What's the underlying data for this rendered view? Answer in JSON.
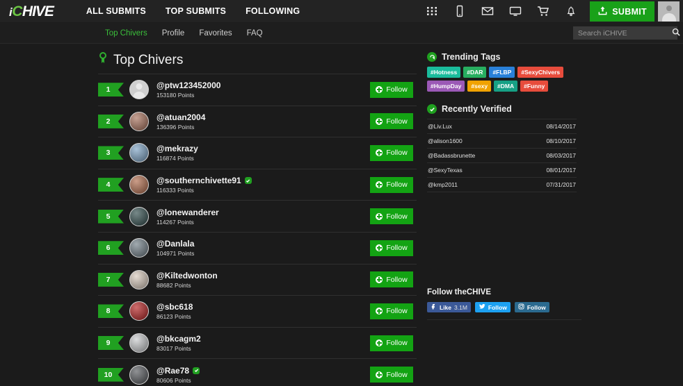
{
  "header": {
    "logo": {
      "i": "i",
      "c": "C",
      "rest": "HIVE"
    },
    "nav": [
      {
        "label": "ALL SUBMITS",
        "name": "nav-all-submits"
      },
      {
        "label": "TOP SUBMITS",
        "name": "nav-top-submits"
      },
      {
        "label": "FOLLOWING",
        "name": "nav-following"
      }
    ],
    "icons": [
      "grid-icon",
      "phone-icon",
      "envelope-icon",
      "monitor-icon",
      "cart-icon",
      "bell-icon"
    ],
    "submit_label": "SUBMIT",
    "avatar": "user-avatar"
  },
  "subnav": {
    "items": [
      {
        "label": "Top Chivers",
        "active": true
      },
      {
        "label": "Profile",
        "active": false
      },
      {
        "label": "Favorites",
        "active": false
      },
      {
        "label": "FAQ",
        "active": false
      }
    ],
    "search": {
      "placeholder": "Search iCHIVE",
      "value": ""
    }
  },
  "main": {
    "title": "Top Chivers",
    "follow_label": "Follow",
    "chivers": [
      {
        "rank": "1",
        "name": "@ptw123452000",
        "points": "153180 Points",
        "verified": false,
        "avatar": "#cfcfcf",
        "placeholder": true
      },
      {
        "rank": "2",
        "name": "@atuan2004",
        "points": "136396 Points",
        "verified": false,
        "avatar": "#a8705a",
        "placeholder": false
      },
      {
        "rank": "3",
        "name": "@mekrazy",
        "points": "116874 Points",
        "verified": false,
        "avatar": "#7ba2c4",
        "placeholder": false
      },
      {
        "rank": "4",
        "name": "@southernchivette91",
        "points": "116333 Points",
        "verified": true,
        "avatar": "#b06a4a",
        "placeholder": false
      },
      {
        "rank": "5",
        "name": "@lonewanderer",
        "points": "114267 Points",
        "verified": false,
        "avatar": "#2e4a4a",
        "placeholder": false
      },
      {
        "rank": "6",
        "name": "@Danlala",
        "points": "104971 Points",
        "verified": false,
        "avatar": "#6f7d86",
        "placeholder": false
      },
      {
        "rank": "7",
        "name": "@Kiltedwonton",
        "points": "88682 Points",
        "verified": false,
        "avatar": "#d9cbbd",
        "placeholder": false
      },
      {
        "rank": "8",
        "name": "@sbc618",
        "points": "86123 Points",
        "verified": false,
        "avatar": "#b61f1f",
        "placeholder": false
      },
      {
        "rank": "9",
        "name": "@bkcagm2",
        "points": "83017 Points",
        "verified": false,
        "avatar": "#c9cbcd",
        "placeholder": false
      },
      {
        "rank": "10",
        "name": "@Rae78",
        "points": "80606 Points",
        "verified": true,
        "avatar": "#55585c",
        "placeholder": false
      }
    ]
  },
  "sidebar": {
    "trending": {
      "title": "Trending Tags",
      "tags": [
        {
          "label": "#Hotness",
          "color": "#1abc9c"
        },
        {
          "label": "#DAR",
          "color": "#27ae60"
        },
        {
          "label": "#FLBP",
          "color": "#2980d9"
        },
        {
          "label": "#SexyChivers",
          "color": "#e74c3c"
        },
        {
          "label": "#HumpDay",
          "color": "#9b59b6"
        },
        {
          "label": "#sexy",
          "color": "#f0a202"
        },
        {
          "label": "#DMA",
          "color": "#16a085"
        },
        {
          "label": "#Funny",
          "color": "#e74c3c"
        }
      ]
    },
    "recently_verified": {
      "title": "Recently Verified",
      "rows": [
        {
          "user": "@Liv.Lux",
          "date": "08/14/2017"
        },
        {
          "user": "@alison1600",
          "date": "08/10/2017"
        },
        {
          "user": "@Badassbrunette",
          "date": "08/03/2017"
        },
        {
          "user": "@SexyTexas",
          "date": "08/01/2017"
        },
        {
          "user": "@kmp2011",
          "date": "07/31/2017"
        }
      ]
    },
    "follow_chive": {
      "title": "Follow theCHIVE",
      "buttons": [
        {
          "label": "Like",
          "count": "3.1M",
          "network": "facebook",
          "class": "fb"
        },
        {
          "label": "Follow",
          "count": "",
          "network": "twitter",
          "class": "tw"
        },
        {
          "label": "Follow",
          "count": "",
          "network": "instagram",
          "class": "ig"
        }
      ]
    }
  },
  "colors": {
    "accent_green": "#19a119",
    "page_bg": "#1b1b1b",
    "header_bg": "#232323"
  }
}
